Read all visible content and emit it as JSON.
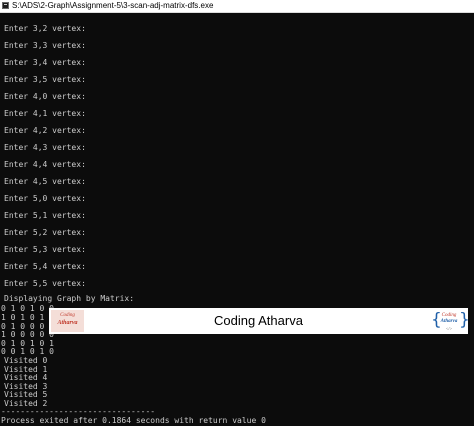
{
  "window": {
    "title": "S:\\ADS\\2-Graph\\Assignment-5\\3-scan-adj-matrix-dfs.exe"
  },
  "console": {
    "prompts": [
      "Enter 3,2 vertex:",
      "Enter 3,3 vertex:",
      "Enter 3,4 vertex:",
      "Enter 3,5 vertex:",
      "Enter 4,0 vertex:",
      "Enter 4,1 vertex:",
      "Enter 4,2 vertex:",
      "Enter 4,3 vertex:",
      "Enter 4,4 vertex:",
      "Enter 4,5 vertex:",
      "Enter 5,0 vertex:",
      "Enter 5,1 vertex:",
      "Enter 5,2 vertex:",
      "Enter 5,3 vertex:",
      "Enter 5,4 vertex:",
      "Enter 5,5 vertex:"
    ],
    "display_heading": "Displaying Graph by Matrix:",
    "matrix_rows": [
      "0 1 0 1 0 0",
      "1 0 1 0 1 0",
      "0 1 0 0 0 1",
      "1 0 0 0 0 0",
      "0 1 0 1 0 1",
      "0 0 1 0 1 0"
    ],
    "visited": [
      "Visited 0",
      "Visited 1",
      "Visited 4",
      "Visited 3",
      "Visited 5",
      "Visited 2"
    ],
    "separator": "--------------------------------",
    "exit_message": "Process exited after 0.1864 seconds with return value 0"
  },
  "banner": {
    "title": "Coding Atharva",
    "logo_left": {
      "line1": "Coding",
      "line2": "Atharva"
    },
    "logo_right": {
      "line1": "Coding",
      "line2": "Atharva",
      "line3": "</>"
    }
  },
  "colors": {
    "console_background": "#0c0c0c",
    "console_text": "#cccccc",
    "banner_background": "#ffffff",
    "logo_red": "#c0392b",
    "logo_blue": "#1f5fa8"
  },
  "icons": {
    "window_icon": "console-app-icon"
  }
}
